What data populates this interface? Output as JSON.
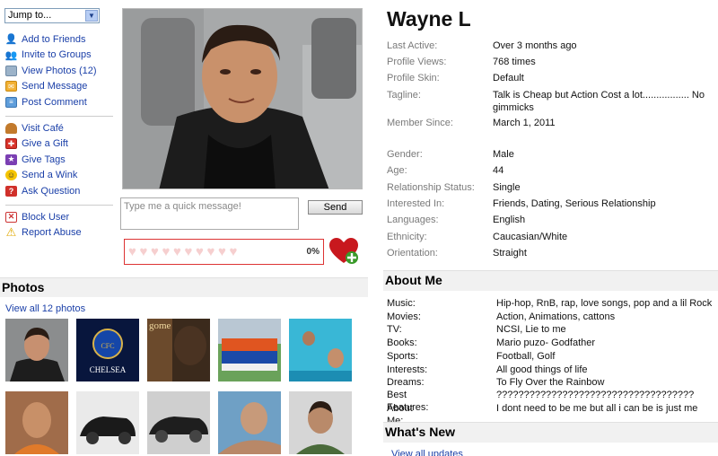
{
  "nav": {
    "jump_label": "Jump to...",
    "group1": [
      {
        "label": "Add to Friends",
        "icon": "add-friend-icon"
      },
      {
        "label": "Invite to Groups",
        "icon": "invite-groups-icon"
      },
      {
        "label": "View Photos (12)",
        "icon": "photos-icon"
      },
      {
        "label": "Send Message",
        "icon": "envelope-icon"
      },
      {
        "label": "Post Comment",
        "icon": "comment-icon"
      }
    ],
    "group2": [
      {
        "label": "Visit Café",
        "icon": "burger-icon"
      },
      {
        "label": "Give a Gift",
        "icon": "gift-icon"
      },
      {
        "label": "Give Tags",
        "icon": "star-icon"
      },
      {
        "label": "Send a Wink",
        "icon": "smiley-icon"
      },
      {
        "label": "Ask Question",
        "icon": "question-icon"
      }
    ],
    "group3": [
      {
        "label": "Block User",
        "icon": "block-icon"
      },
      {
        "label": "Report Abuse",
        "icon": "warning-icon"
      }
    ]
  },
  "quick_message": {
    "placeholder": "Type me a quick message!",
    "send_label": "Send"
  },
  "hearts": {
    "count": 10,
    "percent": "0%"
  },
  "photos": {
    "title": "Photos",
    "view_all": "View all 12 photos"
  },
  "profile": {
    "name": "Wayne L",
    "details": [
      {
        "k": "Last Active:",
        "v": "Over 3 months ago"
      },
      {
        "k": "Profile Views:",
        "v": "768 times"
      },
      {
        "k": "Profile Skin:",
        "v": "Default"
      },
      {
        "k": "Tagline:",
        "v": "Talk is Cheap but Action Cost a lot................. No gimmicks"
      },
      {
        "k": "Member Since:",
        "v": "March 1, 2011"
      },
      {
        "k": "Gender:",
        "v": "Male"
      },
      {
        "k": "Age:",
        "v": "44"
      },
      {
        "k": "Relationship Status:",
        "v": "Single"
      },
      {
        "k": "Interested In:",
        "v": "Friends, Dating, Serious Relationship"
      },
      {
        "k": "Languages:",
        "v": "English"
      },
      {
        "k": "Ethnicity:",
        "v": "Caucasian/White"
      },
      {
        "k": "Orientation:",
        "v": "Straight"
      }
    ]
  },
  "about": {
    "title": "About Me",
    "rows": [
      {
        "k": "Music:",
        "v": "Hip-hop, RnB, rap, love songs, pop and a lil Rock"
      },
      {
        "k": "Movies:",
        "v": "Action, Animations, cattons"
      },
      {
        "k": "TV:",
        "v": "NCSI, Lie to me"
      },
      {
        "k": "Books:",
        "v": "Mario puzo- Godfather"
      },
      {
        "k": "Sports:",
        "v": "Football, Golf"
      },
      {
        "k": "Interests:",
        "v": "All good things of life"
      },
      {
        "k": "Dreams:",
        "v": "To Fly Over the Rainbow"
      },
      {
        "k": "Best Features:",
        "v": "????????????????????????????????????"
      },
      {
        "k": "About Me:",
        "v": "I dont need to be me but all i can be is just me"
      }
    ]
  },
  "whats_new": {
    "title": "What's New",
    "view_all": "View all updates"
  },
  "thumb_texts": {
    "chelsea": "CHELSEA",
    "book": "gome"
  }
}
